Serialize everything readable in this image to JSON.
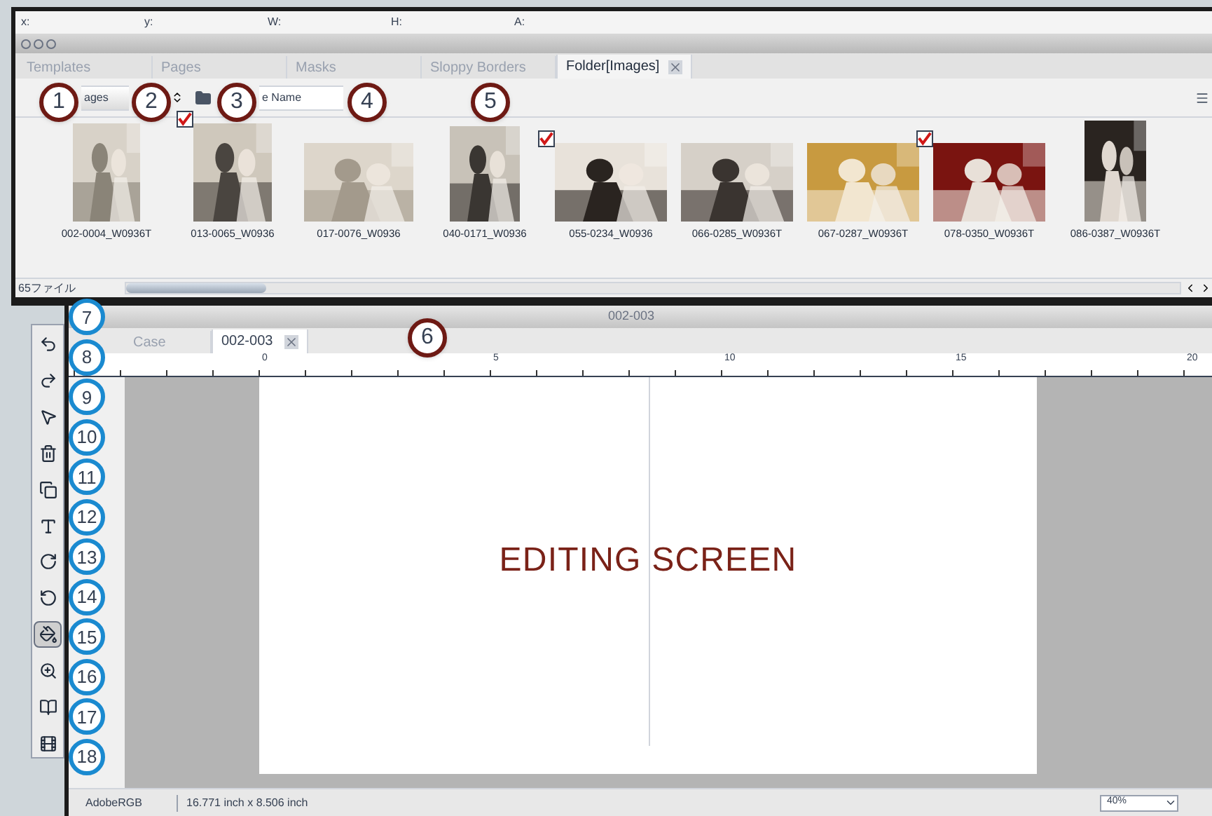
{
  "coordinates": [
    "x:",
    "y:",
    "W:",
    "H:",
    "A:"
  ],
  "library_tabs": [
    {
      "label": "Templates",
      "selected": false
    },
    {
      "label": "Pages",
      "selected": false
    },
    {
      "label": "Masks",
      "selected": false
    },
    {
      "label": "Sloppy Borders",
      "selected": false
    },
    {
      "label": "Folder[Images]",
      "selected": true
    }
  ],
  "toolbar": {
    "folder_dropdown": "ages",
    "sort_dropdown": "e Name"
  },
  "thumbnails": [
    {
      "caption": "002-0004_W0936T",
      "checked": false
    },
    {
      "caption": "013-0065_W0936",
      "checked": true
    },
    {
      "caption": "017-0076_W0936",
      "checked": false
    },
    {
      "caption": "040-0171_W0936",
      "checked": false
    },
    {
      "caption": "055-0234_W0936",
      "checked": true
    },
    {
      "caption": "066-0285_W0936T",
      "checked": false
    },
    {
      "caption": "067-0287_W0936T",
      "checked": false
    },
    {
      "caption": "078-0350_W0936T",
      "checked": true
    },
    {
      "caption": "086-0387_W0936T",
      "checked": false
    }
  ],
  "file_count": "65ファイル",
  "document": {
    "title": "002-003",
    "tabs": [
      {
        "label": "Case",
        "selected": false
      },
      {
        "label": "002-003",
        "selected": true
      }
    ]
  },
  "ruler_labels": [
    "0",
    "5",
    "10",
    "15",
    "20"
  ],
  "tools": [
    {
      "selected": false
    },
    {
      "selected": false
    },
    {
      "selected": false
    },
    {
      "selected": false
    },
    {
      "selected": false
    },
    {
      "selected": false
    },
    {
      "selected": false
    },
    {
      "selected": false
    },
    {
      "selected": true
    },
    {
      "selected": false
    },
    {
      "selected": false
    },
    {
      "selected": false
    }
  ],
  "overlay_title": "EDITING SCREEN",
  "status_bar": {
    "color_profile": "AdobeRGB",
    "page_size": "16.771 inch x 8.506 inch",
    "zoom": "40%"
  },
  "callouts": [
    {
      "number": "1",
      "kind": "panel"
    },
    {
      "number": "2",
      "kind": "panel"
    },
    {
      "number": "3",
      "kind": "panel"
    },
    {
      "number": "4",
      "kind": "panel"
    },
    {
      "number": "5",
      "kind": "panel"
    },
    {
      "number": "6",
      "kind": "panel"
    },
    {
      "number": "7",
      "kind": "tool"
    },
    {
      "number": "8",
      "kind": "tool"
    },
    {
      "number": "9",
      "kind": "tool"
    },
    {
      "number": "10",
      "kind": "tool"
    },
    {
      "number": "11",
      "kind": "tool"
    },
    {
      "number": "12",
      "kind": "tool"
    },
    {
      "number": "13",
      "kind": "tool"
    },
    {
      "number": "14",
      "kind": "tool"
    },
    {
      "number": "15",
      "kind": "tool"
    },
    {
      "number": "16",
      "kind": "tool"
    },
    {
      "number": "17",
      "kind": "tool"
    },
    {
      "number": "18",
      "kind": "tool"
    }
  ]
}
